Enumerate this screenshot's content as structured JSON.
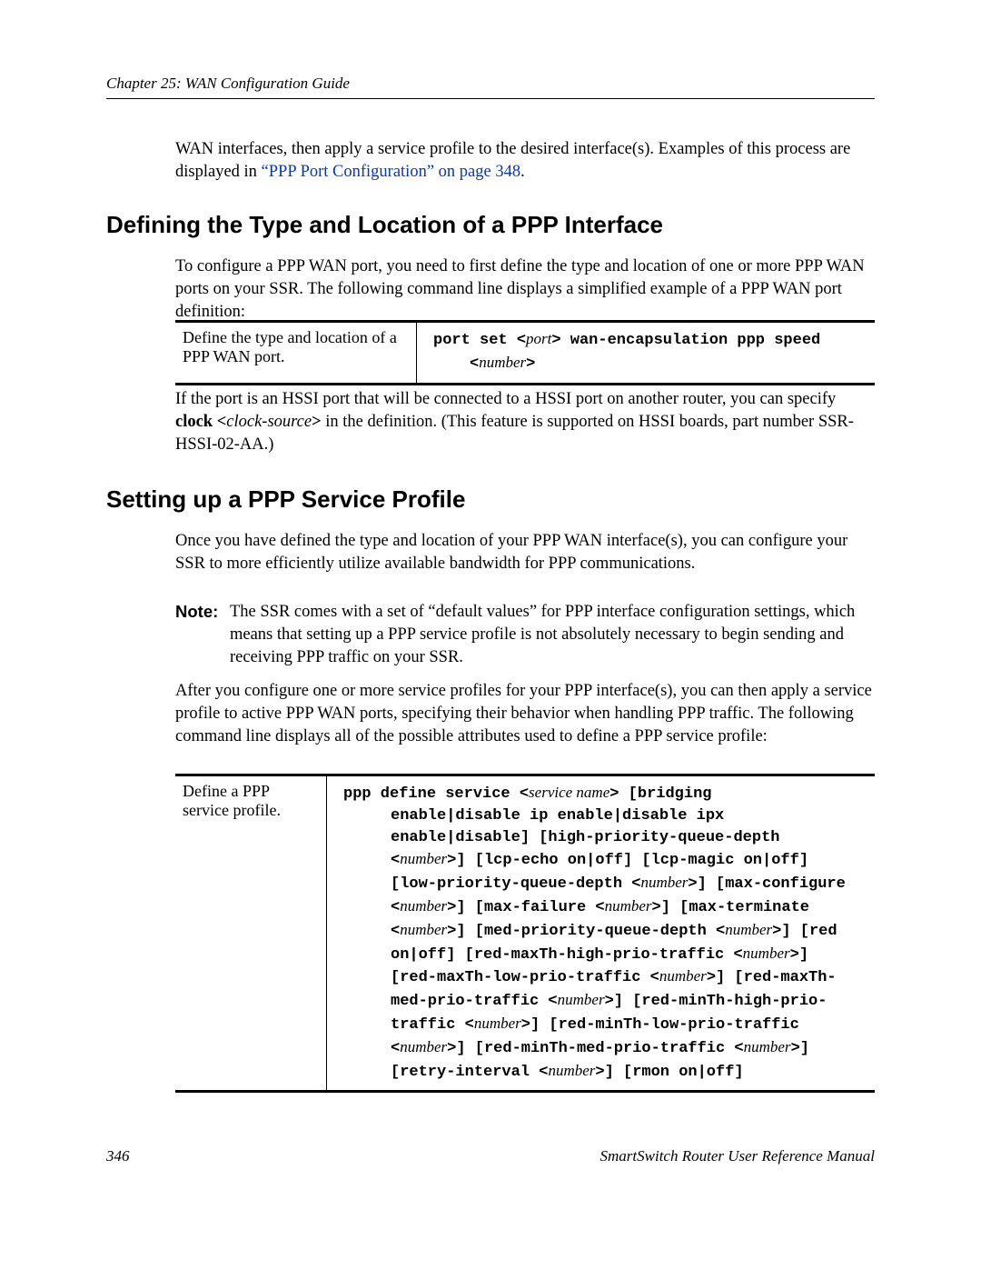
{
  "header": {
    "chapter": "Chapter 25: WAN Configuration Guide"
  },
  "intro": {
    "line1_pre": "WAN interfaces, then apply a service profile to the desired interface(s). Examples of this process are displayed in ",
    "link_text": "“PPP Port Configuration” on page 348",
    "line1_post": "."
  },
  "section1": {
    "title": "Defining the Type and Location of a PPP Interface",
    "para1": "To configure a PPP WAN port, you need to first define the type and location of one or more PPP WAN ports on your SSR. The following command line displays a simplified example of a PPP WAN port definition:",
    "table": {
      "left": "Define the type and location of a PPP WAN port.",
      "right_pre": "port set <",
      "right_var1": "port",
      "right_mid": "> wan-encapsulation ppp speed",
      "right_lt": "<",
      "right_var2": "number",
      "right_gt": ">"
    },
    "para2_pre": "If the port is an HSSI port that will be connected to a HSSI port on another router, you can specify ",
    "para2_bold": "clock <",
    "para2_var": "clock-source",
    "para2_boldclose": ">",
    "para2_post": " in the definition. (This feature is supported on HSSI boards, part number SSR-HSSI-02-AA.)"
  },
  "section2": {
    "title": "Setting up a PPP Service Profile",
    "para1": "Once you have defined the type and location of your PPP WAN interface(s), you can configure your SSR to more efficiently utilize available bandwidth for PPP communications.",
    "note_label": "Note:",
    "note_text": "The SSR comes with a set of “default values” for PPP interface configuration settings, which means that setting up a PPP service profile is not absolutely necessary to begin sending and receiving PPP traffic on your SSR.",
    "para2": "After you configure one or more service profiles for your PPP interface(s), you can then apply a service profile to active PPP WAN ports, specifying their behavior when handling PPP traffic. The following command line displays all of the possible attributes used to define a PPP service profile:",
    "table": {
      "left": "Define a PPP service profile.",
      "cmd": {
        "l1a": "ppp define service <",
        "l1v": "service name",
        "l1b": "> [bridging",
        "l2": "enable|disable ip enable|disable ipx",
        "l3": "enable|disable] [high-priority-queue-depth",
        "l4a": "<",
        "l4v": "number",
        "l4b": ">] [lcp-echo on|off] [lcp-magic on|off]",
        "l5a": "[low-priority-queue-depth <",
        "l5v": "number",
        "l5b": ">] [max-configure",
        "l6a": "<",
        "l6v": "number",
        "l6b": ">] [max-failure <",
        "l6v2": "number",
        "l6c": ">] [max-terminate",
        "l7a": "<",
        "l7v": "number",
        "l7b": ">] [med-priority-queue-depth <",
        "l7v2": "number",
        "l7c": ">] [red",
        "l8a": "on|off] [red-maxTh-high-prio-traffic <",
        "l8v": "number",
        "l8b": ">]",
        "l9a": "[red-maxTh-low-prio-traffic <",
        "l9v": "number",
        "l9b": ">] [red-maxTh-",
        "l10a": "med-prio-traffic <",
        "l10v": "number",
        "l10b": ">] [red-minTh-high-prio-",
        "l11a": "traffic <",
        "l11v": "number",
        "l11b": ">] [red-minTh-low-prio-traffic",
        "l12a": "<",
        "l12v": "number",
        "l12b": ">] [red-minTh-med-prio-traffic <",
        "l12v2": "number",
        "l12c": ">]",
        "l13a": "[retry-interval <",
        "l13v": "number",
        "l13b": ">] [rmon on|off]"
      }
    }
  },
  "footer": {
    "page": "346",
    "manual": "SmartSwitch Router User Reference Manual"
  }
}
